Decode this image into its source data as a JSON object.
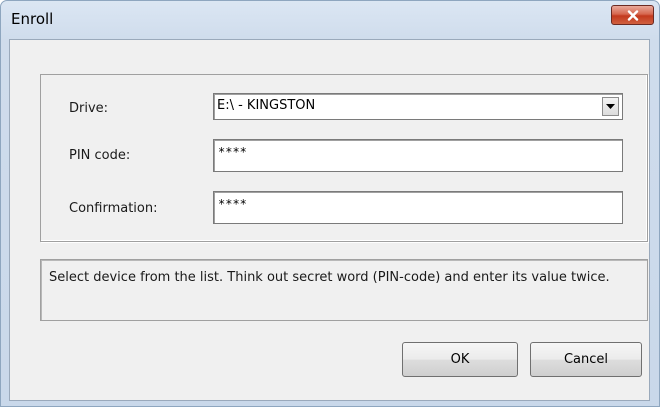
{
  "window": {
    "title": "Enroll"
  },
  "form": {
    "drive_label": "Drive:",
    "drive_value": "E:\\ - KINGSTON",
    "pin_label": "PIN code:",
    "pin_value": "****",
    "confirm_label": "Confirmation:",
    "confirm_value": "****"
  },
  "info": {
    "text": "Select device from the list. Think out secret word (PIN-code) and enter its value twice."
  },
  "buttons": {
    "ok": "OK",
    "cancel": "Cancel"
  },
  "colors": {
    "close_button": "#c3391e",
    "titlebar": "#dbe6f3"
  },
  "icons": {
    "close": "close-x-icon",
    "dropdown": "chevron-down-icon"
  }
}
